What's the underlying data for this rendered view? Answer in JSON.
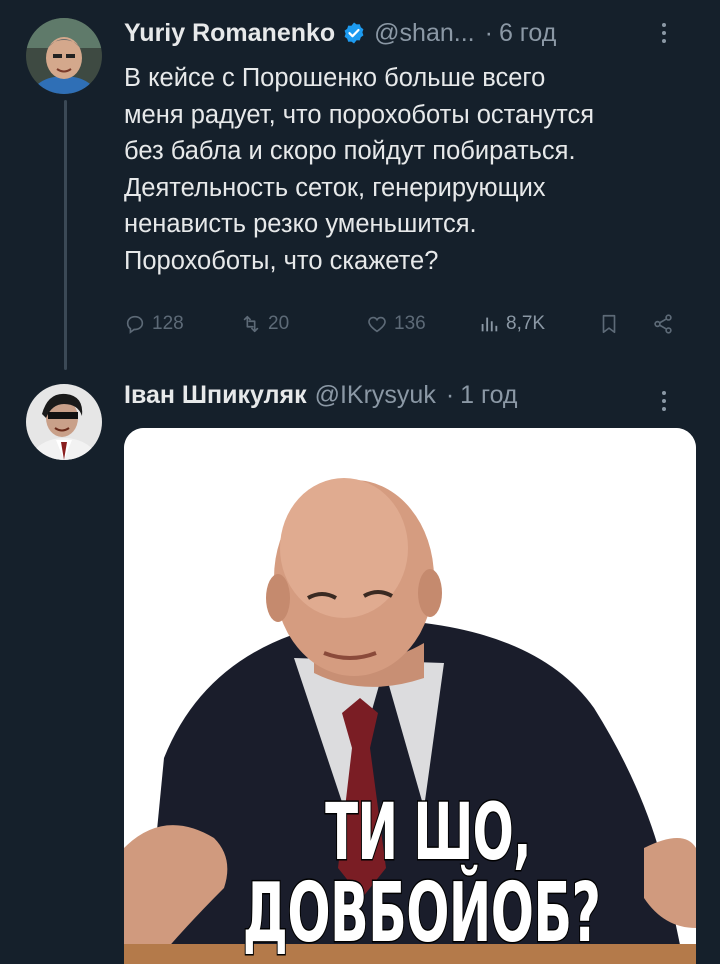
{
  "tweets": [
    {
      "author_name": "Yuriy Romanenko",
      "verified": true,
      "handle": "@shan...",
      "separator": "·",
      "time": "6 год",
      "text": "В кейсе с Порошенко больше всего\nменя радует, что порохоботы останутся\nбез бабла и скоро пойдут побираться.\nДеятельность сеток, генерирующих\nненависть резко уменьшится.\nПорохоботы, что скажете?",
      "stats": {
        "replies": "128",
        "retweets": "20",
        "likes": "136",
        "views": "8,7K"
      }
    },
    {
      "author_name": "Іван Шпикуляк",
      "handle": "@IKrysyuk",
      "separator": "·",
      "time": "1 год",
      "media": {
        "caption_line1": "ТИ ШО,",
        "caption_line2": "ДОВБОЙОБ?"
      }
    }
  ],
  "colors": {
    "background": "#15202b",
    "text_primary": "#e7e9ea",
    "text_secondary": "#8b98a5",
    "verified_blue": "#1d9bf0"
  },
  "icons": [
    "reply-icon",
    "retweet-icon",
    "like-icon",
    "views-icon",
    "bookmark-icon",
    "share-icon",
    "more-icon",
    "verified-badge-icon"
  ]
}
